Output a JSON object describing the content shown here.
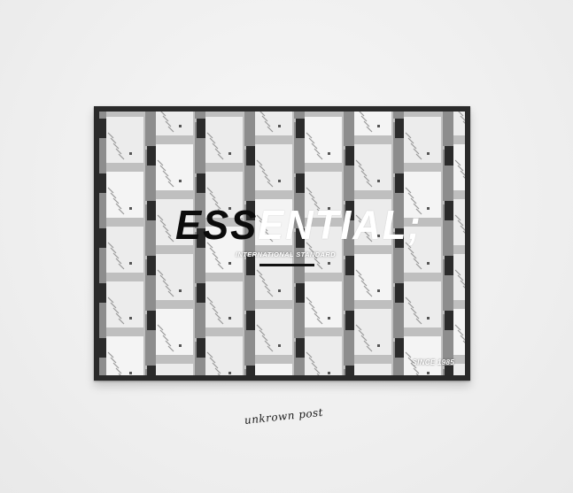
{
  "poster": {
    "title_part1": "ESS",
    "title_part2": "ENTIAL;",
    "subtitle": "INTERNATIONAL STANDARD",
    "since": "SINCE 1985"
  },
  "caption": {
    "text": "unkrown post"
  },
  "colors": {
    "wall": "#efefef",
    "frame": "#2a2a2a",
    "title_dark": "#0b0b0b",
    "title_light": "#ffffff"
  },
  "photo": {
    "subject": "black-and-white balconies facade"
  }
}
